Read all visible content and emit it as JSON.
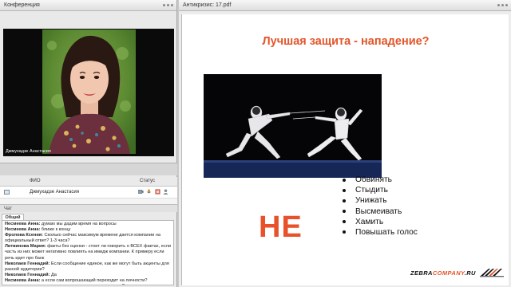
{
  "left_panel": {
    "title": "Конференция"
  },
  "right_panel": {
    "title": "Антикризис: 17.pdf"
  },
  "video": {
    "name": "Джмухадзе Анастасия"
  },
  "attendees": {
    "columns": {
      "name": "ФИО",
      "status": "Статус"
    },
    "rows": [
      {
        "name": "Джмухадзе Анастасия"
      }
    ]
  },
  "chat": {
    "title": "Чат",
    "tab": "Общий",
    "messages": [
      {
        "author": "Несмеева Анна:",
        "text": " думаю мы дадим время на вопросы"
      },
      {
        "author": "Несмеева Анна:",
        "text": " ближе к концу"
      },
      {
        "author": "Фролова Ксения:",
        "text": " Сколько сейчас максимум времени дается компании на официальный ответ? 1-3 часа?"
      },
      {
        "author": "Литвинова Мария:",
        "text": " факты без оценки - стоит ли говорить о ВСЕХ фактах, если часть из них может негативно повлиять на имидж компании. К примеру если речь идет про банк"
      },
      {
        "author": "Николаев Геннадий:",
        "text": " Если сообщение единое, как же могут быть акценты для разной аудитории?"
      },
      {
        "author": "Николаев Геннадий:",
        "text": " Да"
      },
      {
        "author": "Несмеева Анна:",
        "text": " а если сам вопрошающий переходит на личности? комментирует личность модератора или коммуникатора?"
      }
    ]
  },
  "slide": {
    "title": "Лучшая защита - нападение?",
    "ne": "НЕ",
    "bullets": [
      "Обвинять",
      "Стыдить",
      "Унижать",
      "Высмеивать",
      "Хамить",
      "Повышать голос"
    ],
    "logo_main": "ZEBRA",
    "logo_accent": "COMPANY",
    "logo_tail": ".RU"
  },
  "colors": {
    "accent": "#e2552a",
    "panel_bg": "#e9e9e9"
  }
}
